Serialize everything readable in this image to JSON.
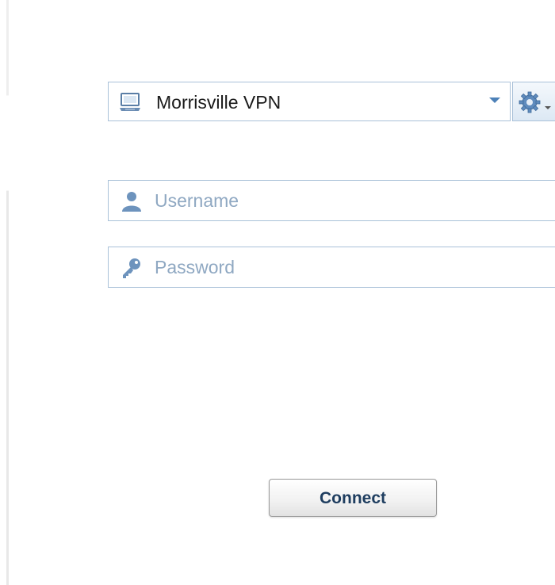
{
  "profile": {
    "selected": "Morrisville VPN",
    "icon": "monitor-icon"
  },
  "settings": {
    "icon": "gear-icon"
  },
  "username": {
    "placeholder": "Username",
    "value": "",
    "icon": "user-icon"
  },
  "password": {
    "placeholder": "Password",
    "value": "",
    "icon": "key-icon"
  },
  "connect": {
    "label": "Connect"
  },
  "colors": {
    "border": "#a9c1d8",
    "accent": "#4d81b8",
    "placeholder": "#8fa8c2",
    "button_text": "#1f3e60"
  }
}
